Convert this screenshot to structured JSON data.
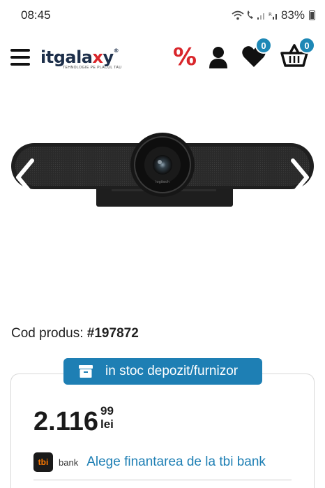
{
  "status_bar": {
    "time": "08:45",
    "battery": "83%",
    "icons": [
      "wifi-icon",
      "call-icon",
      "signal-icon",
      "signal-r-icon",
      "battery-icon"
    ]
  },
  "header": {
    "logo": {
      "name": "itgalaxy",
      "tagline": "TEHNOLOGIE PE PLACUL TAU"
    },
    "icons": [
      "menu-icon",
      "percent-icon",
      "user-icon",
      "heart-icon",
      "cart-icon"
    ],
    "percent_symbol": "%",
    "wishlist_count": "0",
    "cart_count": "0",
    "colors": {
      "accent_red": "#d9262b",
      "badge_blue": "#1e88b6"
    }
  },
  "gallery": {
    "image": "conference-camera-soundbar",
    "icons": [
      "chevron-left-icon",
      "chevron-right-icon"
    ]
  },
  "product": {
    "code_label": "Cod produs:",
    "code_value": "#197872",
    "stock_label": "in stoc depozit/furnizor",
    "price_main": "2.116",
    "price_decimals": "99",
    "currency": "lei",
    "financing": {
      "brand": "tbi",
      "brand_suffix": "bank",
      "link_text": "Alege finantarea de la tbi bank"
    },
    "colors": {
      "primary_blue": "#1e7fb4"
    }
  }
}
